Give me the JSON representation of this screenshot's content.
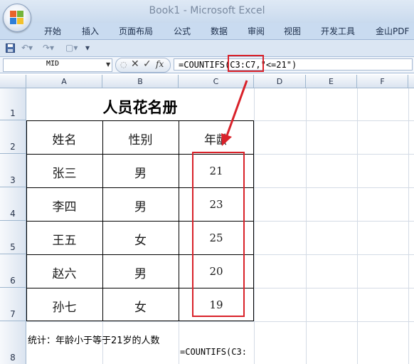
{
  "window": {
    "title": "Book1 - Microsoft Excel"
  },
  "ribbon": {
    "tabs": [
      "开始",
      "插入",
      "页面布局",
      "公式",
      "数据",
      "审阅",
      "视图",
      "开发工具",
      "金山PDF"
    ]
  },
  "qat": {
    "icons": [
      "save-icon",
      "undo-icon",
      "redo-icon",
      "print-preview-icon",
      "customize-qat-icon"
    ]
  },
  "formula_bar": {
    "name_box": "MID",
    "fx_label": "fx",
    "formula": "=COUNTIFS(C3:C7,\"<=21\")"
  },
  "grid": {
    "columns": [
      "A",
      "B",
      "C",
      "D",
      "E",
      "F"
    ],
    "rows": [
      "1",
      "2",
      "3",
      "4",
      "5",
      "6",
      "7",
      "8"
    ],
    "title": "人员花名册",
    "headers": [
      "姓名",
      "性别",
      "年龄"
    ],
    "records": [
      {
        "name": "张三",
        "gender": "男",
        "age": "21"
      },
      {
        "name": "李四",
        "gender": "男",
        "age": "23"
      },
      {
        "name": "王五",
        "gender": "女",
        "age": "25"
      },
      {
        "name": "赵六",
        "gender": "男",
        "age": "20"
      },
      {
        "name": "孙七",
        "gender": "女",
        "age": "19"
      }
    ],
    "note": "统计：年龄小于等于21岁的人数",
    "c8": "=COUNTIFS(C3:"
  },
  "annotation": {
    "color": "#d9222a"
  }
}
